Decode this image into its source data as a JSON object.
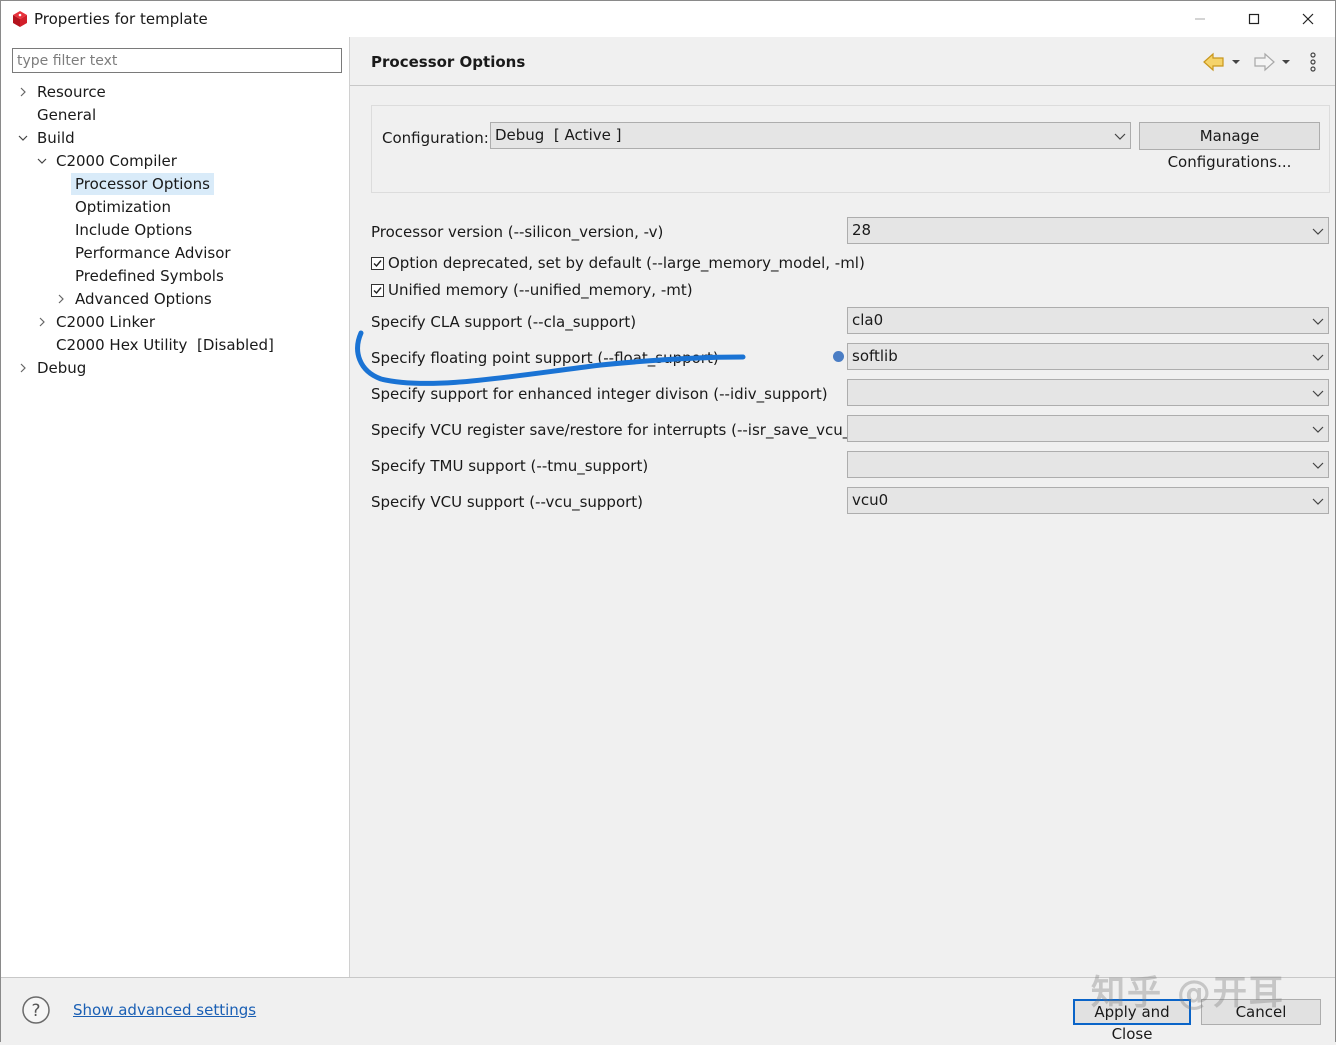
{
  "window": {
    "title": "Properties for template"
  },
  "filter": {
    "placeholder": "type filter text"
  },
  "tree": {
    "resource": "Resource",
    "general": "General",
    "build": "Build",
    "compiler": "C2000 Compiler",
    "processor_options": "Processor Options",
    "optimization": "Optimization",
    "include_options": "Include Options",
    "performance_advisor": "Performance Advisor",
    "predefined_symbols": "Predefined Symbols",
    "advanced_options": "Advanced Options",
    "linker": "C2000 Linker",
    "hex_utility": "C2000 Hex Utility  [Disabled]",
    "debug": "Debug"
  },
  "page": {
    "title": "Processor Options"
  },
  "config": {
    "label": "Configuration:",
    "value": "Debug  [ Active ]",
    "manage_button": "Manage Configurations..."
  },
  "options": {
    "processor_version": {
      "label": "Processor version (--silicon_version, -v)",
      "value": "28"
    },
    "deprecated": {
      "label": "Option deprecated, set by default (--large_memory_model, -ml)",
      "checked": true
    },
    "unified_memory": {
      "label": "Unified memory (--unified_memory, -mt)",
      "checked": true
    },
    "cla_support": {
      "label": "Specify CLA support (--cla_support)",
      "value": "cla0"
    },
    "float_support": {
      "label": "Specify floating point support (--float_support)",
      "value": "softlib"
    },
    "idiv_support": {
      "label": "Specify support for enhanced integer divison (--idiv_support)",
      "value": ""
    },
    "isr_save": {
      "label": "Specify VCU register save/restore for interrupts (--isr_save_vcu_regs)",
      "value": ""
    },
    "tmu_support": {
      "label": "Specify TMU support (--tmu_support)",
      "value": ""
    },
    "vcu_support": {
      "label": "Specify VCU support (--vcu_support)",
      "value": "vcu0"
    }
  },
  "footer": {
    "advanced_link": "Show advanced settings",
    "apply_close": "Apply and Close",
    "cancel": "Cancel",
    "watermark": "知乎 @开耳"
  },
  "colors": {
    "selection": "#d9ebf9",
    "link": "#1a5fb4",
    "annotation_stroke": "#1a73d4",
    "default_button_border": "#0a64c8"
  }
}
